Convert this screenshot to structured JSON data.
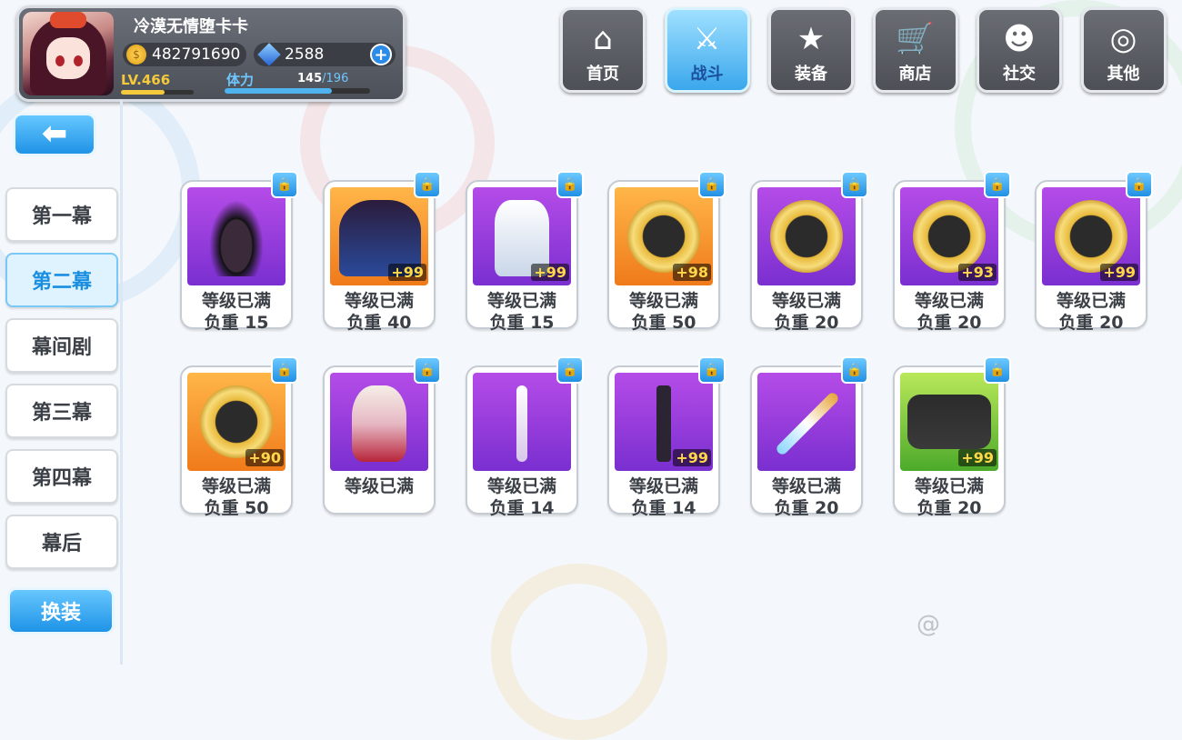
{
  "player": {
    "name": "冷漠无情堕卡卡",
    "gold": "482791690",
    "gems": "2588",
    "plus": "+",
    "level": "LV.466",
    "stamina_label": "体力",
    "stamina_current": "145",
    "stamina_max": "/196",
    "level_progress": 0.6,
    "stamina_progress": 0.74
  },
  "nav": [
    {
      "label": "首页",
      "icon": "house-icon"
    },
    {
      "label": "战斗",
      "icon": "swords-icon",
      "active": true
    },
    {
      "label": "装备",
      "icon": "gun-star-icon"
    },
    {
      "label": "商店",
      "icon": "basket-icon"
    },
    {
      "label": "社交",
      "icon": "ghost-icon"
    },
    {
      "label": "其他",
      "icon": "target-icon"
    }
  ],
  "back_label": "⬅",
  "side_menu": [
    "第一幕",
    "第二幕",
    "幕间剧",
    "第三幕",
    "第四幕",
    "幕后"
  ],
  "side_active": 1,
  "swap_label": "换装",
  "watermark": "@",
  "cards": [
    {
      "bg": "purple",
      "art": "lantern",
      "plus": "",
      "status": "等级已满",
      "weight": "负重 15"
    },
    {
      "bg": "orange",
      "art": "witch",
      "plus": "+99",
      "status": "等级已满",
      "weight": "负重 40"
    },
    {
      "bg": "purple",
      "art": "armor",
      "plus": "+99",
      "status": "等级已满",
      "weight": "负重 15"
    },
    {
      "bg": "orange",
      "art": "medal-skull",
      "plus": "+98",
      "status": "等级已满",
      "weight": "负重 50"
    },
    {
      "bg": "purple",
      "art": "medal-girl",
      "plus": "",
      "status": "等级已满",
      "weight": "负重 20"
    },
    {
      "bg": "purple",
      "art": "medal-eye",
      "plus": "+93",
      "status": "等级已满",
      "weight": "负重 20"
    },
    {
      "bg": "purple",
      "art": "medal-flame",
      "plus": "+99",
      "status": "等级已满",
      "weight": "负重 20"
    },
    {
      "bg": "orange",
      "art": "medal-wings",
      "plus": "+90",
      "status": "等级已满",
      "weight": "负重 50"
    },
    {
      "bg": "purple",
      "art": "character",
      "plus": "",
      "status": "等级已满",
      "weight": ""
    },
    {
      "bg": "purple",
      "art": "key",
      "plus": "",
      "status": "等级已满",
      "weight": "负重 14"
    },
    {
      "bg": "purple",
      "art": "ankh",
      "plus": "+99",
      "status": "等级已满",
      "weight": "负重 14"
    },
    {
      "bg": "purple",
      "art": "sword",
      "plus": "",
      "status": "等级已满",
      "weight": "负重 20"
    },
    {
      "bg": "green",
      "art": "radiation-gun",
      "plus": "+99",
      "status": "等级已满",
      "weight": "负重 20"
    }
  ]
}
